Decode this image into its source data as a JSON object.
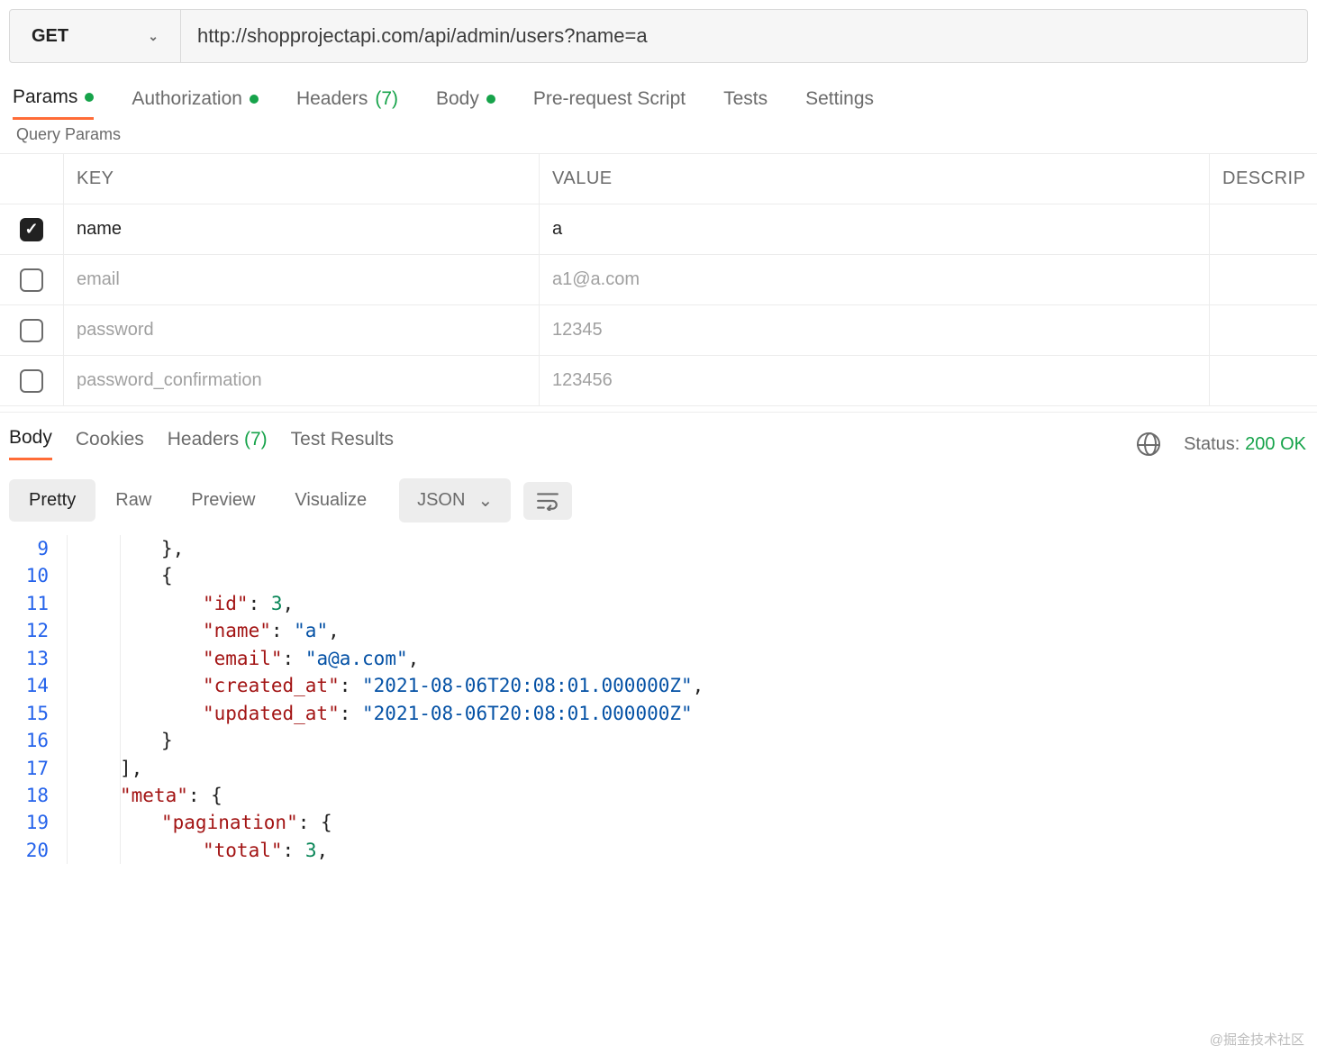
{
  "request": {
    "method": "GET",
    "url": "http://shopprojectapi.com/api/admin/users?name=a"
  },
  "req_tabs": {
    "params": "Params",
    "auth": "Authorization",
    "headers": "Headers",
    "headers_count": "(7)",
    "body": "Body",
    "prereq": "Pre-request Script",
    "tests": "Tests",
    "settings": "Settings"
  },
  "section_label": "Query Params",
  "param_headers": {
    "key": "KEY",
    "value": "VALUE",
    "desc": "DESCRIP"
  },
  "params": [
    {
      "enabled": true,
      "key": "name",
      "value": "a"
    },
    {
      "enabled": false,
      "key": "email",
      "value": "a1@a.com"
    },
    {
      "enabled": false,
      "key": "password",
      "value": "12345"
    },
    {
      "enabled": false,
      "key": "password_confirmation",
      "value": "123456"
    }
  ],
  "resp_tabs": {
    "body": "Body",
    "cookies": "Cookies",
    "headers": "Headers",
    "headers_count": "(7)",
    "tests": "Test Results"
  },
  "status": {
    "label": "Status:",
    "value": "200 OK"
  },
  "body_views": {
    "pretty": "Pretty",
    "raw": "Raw",
    "preview": "Preview",
    "visualize": "Visualize"
  },
  "body_format": "JSON",
  "code_lines": [
    {
      "n": 9,
      "indent": 2,
      "tokens": [
        {
          "t": "p",
          "v": "},"
        }
      ]
    },
    {
      "n": 10,
      "indent": 2,
      "tokens": [
        {
          "t": "p",
          "v": "{"
        }
      ]
    },
    {
      "n": 11,
      "indent": 3,
      "tokens": [
        {
          "t": "k",
          "v": "\"id\""
        },
        {
          "t": "p",
          "v": ": "
        },
        {
          "t": "n",
          "v": "3"
        },
        {
          "t": "p",
          "v": ","
        }
      ]
    },
    {
      "n": 12,
      "indent": 3,
      "tokens": [
        {
          "t": "k",
          "v": "\"name\""
        },
        {
          "t": "p",
          "v": ": "
        },
        {
          "t": "s",
          "v": "\"a\""
        },
        {
          "t": "p",
          "v": ","
        }
      ]
    },
    {
      "n": 13,
      "indent": 3,
      "tokens": [
        {
          "t": "k",
          "v": "\"email\""
        },
        {
          "t": "p",
          "v": ": "
        },
        {
          "t": "s",
          "v": "\"a@a.com\""
        },
        {
          "t": "p",
          "v": ","
        }
      ]
    },
    {
      "n": 14,
      "indent": 3,
      "tokens": [
        {
          "t": "k",
          "v": "\"created_at\""
        },
        {
          "t": "p",
          "v": ": "
        },
        {
          "t": "s",
          "v": "\"2021-08-06T20:08:01.000000Z\""
        },
        {
          "t": "p",
          "v": ","
        }
      ]
    },
    {
      "n": 15,
      "indent": 3,
      "tokens": [
        {
          "t": "k",
          "v": "\"updated_at\""
        },
        {
          "t": "p",
          "v": ": "
        },
        {
          "t": "s",
          "v": "\"2021-08-06T20:08:01.000000Z\""
        }
      ]
    },
    {
      "n": 16,
      "indent": 2,
      "tokens": [
        {
          "t": "p",
          "v": "}"
        }
      ]
    },
    {
      "n": 17,
      "indent": 1,
      "tokens": [
        {
          "t": "p",
          "v": "],"
        }
      ]
    },
    {
      "n": 18,
      "indent": 1,
      "tokens": [
        {
          "t": "k",
          "v": "\"meta\""
        },
        {
          "t": "p",
          "v": ": {"
        }
      ]
    },
    {
      "n": 19,
      "indent": 2,
      "tokens": [
        {
          "t": "k",
          "v": "\"pagination\""
        },
        {
          "t": "p",
          "v": ": {"
        }
      ]
    },
    {
      "n": 20,
      "indent": 3,
      "tokens": [
        {
          "t": "k",
          "v": "\"total\""
        },
        {
          "t": "p",
          "v": ": "
        },
        {
          "t": "n",
          "v": "3"
        },
        {
          "t": "p",
          "v": ","
        }
      ]
    }
  ],
  "watermark": "@掘金技术社区"
}
